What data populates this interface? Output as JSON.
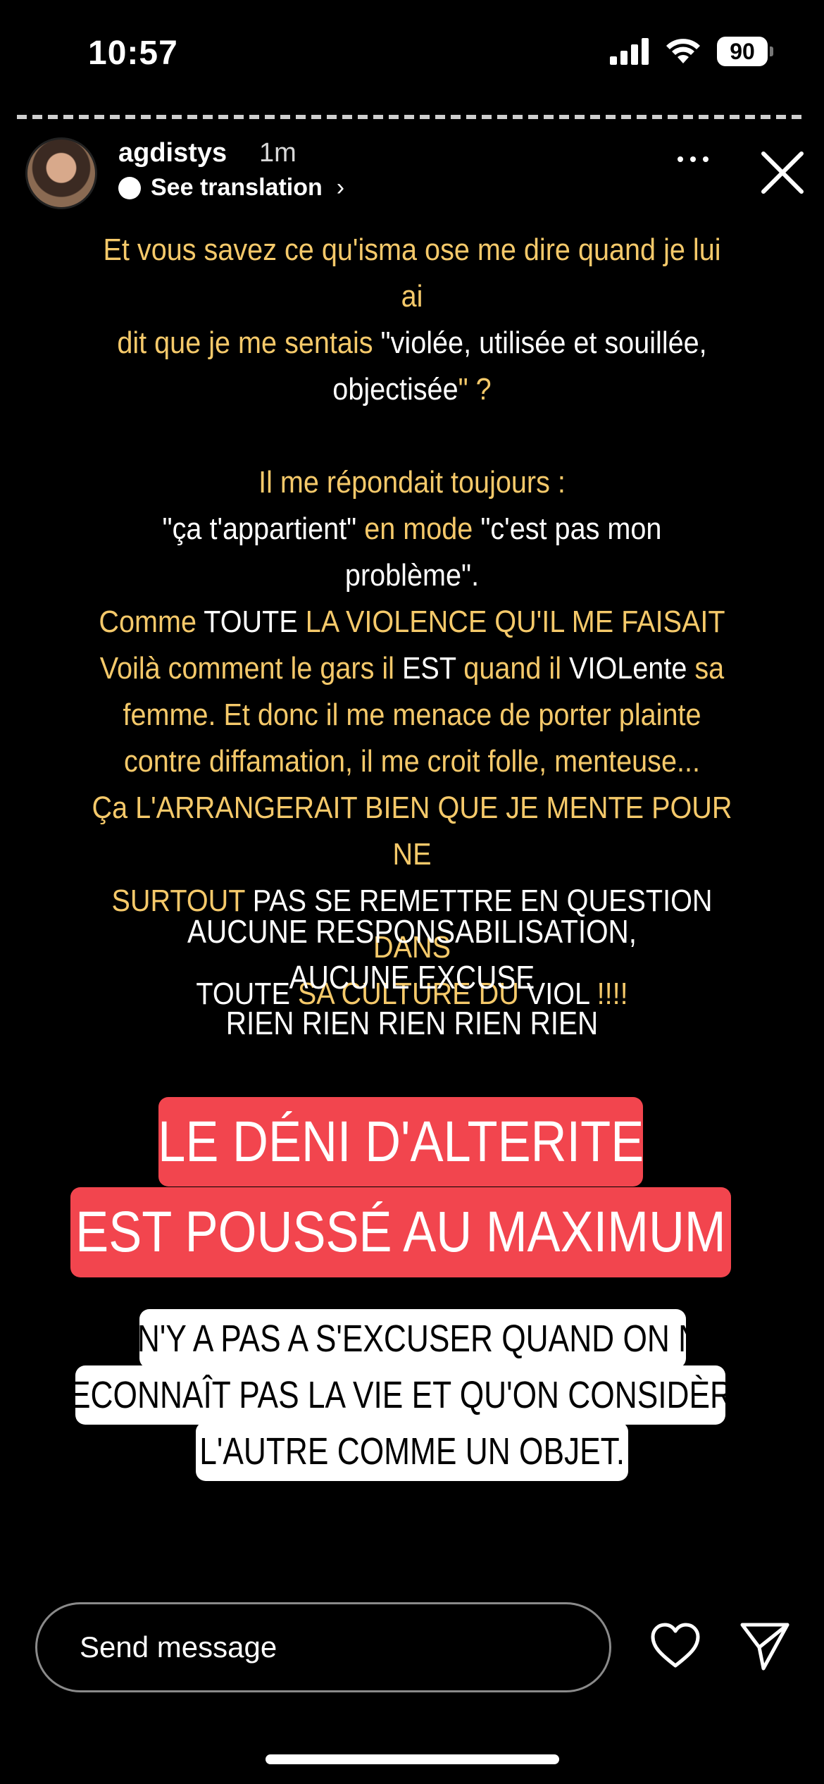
{
  "status_bar": {
    "time": "10:57",
    "battery": "90"
  },
  "header": {
    "username": "agdistys",
    "time_ago": "1m",
    "see_translation": "See translation"
  },
  "story": {
    "paragraph1": [
      [
        {
          "t": "Et vous savez ce qu'isma ose me dire quand je lui ai",
          "c": "y"
        }
      ],
      [
        {
          "t": "dit que je me sentais ",
          "c": "y"
        },
        {
          "t": "\"violée, utilisée et souillée,",
          "c": "w"
        }
      ],
      [
        {
          "t": "objectisée",
          "c": "w"
        },
        {
          "t": "\" ?",
          "c": "y"
        }
      ]
    ],
    "paragraph2": [
      [
        {
          "t": "Il me répondait toujours :",
          "c": "y"
        }
      ],
      [
        {
          "t": "\"ça t'appartient\" ",
          "c": "w"
        },
        {
          "t": "en mode ",
          "c": "y"
        },
        {
          "t": "\"c'est pas mon",
          "c": "w"
        }
      ],
      [
        {
          "t": "problème\".",
          "c": "w"
        }
      ],
      [
        {
          "t": "Comme ",
          "c": "y"
        },
        {
          "t": "TOUTE ",
          "c": "w"
        },
        {
          "t": "LA VIOLENCE QU'IL ME FAISAIT",
          "c": "y"
        }
      ],
      [
        {
          "t": "Voilà comment le gars il ",
          "c": "y"
        },
        {
          "t": "EST ",
          "c": "w"
        },
        {
          "t": "quand il ",
          "c": "y"
        },
        {
          "t": "VIOLente ",
          "c": "w"
        },
        {
          "t": "sa",
          "c": "y"
        }
      ],
      [
        {
          "t": "femme. Et donc il me menace de porter plainte",
          "c": "y"
        }
      ],
      [
        {
          "t": "contre diffamation, il me croit folle, menteuse...",
          "c": "y"
        }
      ],
      [
        {
          "t": "Ça L'ARRANGERAIT BIEN QUE JE MENTE POUR NE",
          "c": "y"
        }
      ],
      [
        {
          "t": "SURTOUT ",
          "c": "y"
        },
        {
          "t": "PAS SE REMETTRE EN QUESTION ",
          "c": "w"
        },
        {
          "t": "DANS",
          "c": "y"
        }
      ],
      [
        {
          "t": "TOUTE ",
          "c": "w"
        },
        {
          "t": "SA CULTURE DU ",
          "c": "y"
        },
        {
          "t": "VIOL ",
          "c": "w"
        },
        {
          "t": "!!!!",
          "c": "y"
        }
      ]
    ],
    "caps_lines": [
      "AUCUNE RESPONSABILISATION,",
      "AUCUNE EXCUSE",
      "RIEN RIEN RIEN RIEN RIEN"
    ],
    "red_lines": [
      "LE DÉNI D'ALTERITE",
      "EST POUSSÉ AU MAXIMUM"
    ],
    "white_lines": [
      "IL N'Y A PAS A S'EXCUSER QUAND ON NE",
      "RECONNAÎT PAS LA VIE ET QU'ON CONSIDÈRE",
      "L'AUTRE COMME UN OBJET."
    ]
  },
  "footer": {
    "send_placeholder": "Send message"
  },
  "colors": {
    "yellow_text": "#f5c96a",
    "red_highlight": "#f2454e",
    "background": "#000000"
  },
  "icons": [
    "signal-icon",
    "wifi-icon",
    "battery-icon",
    "translate-icon",
    "more-icon",
    "close-icon",
    "heart-icon",
    "share-icon"
  ]
}
